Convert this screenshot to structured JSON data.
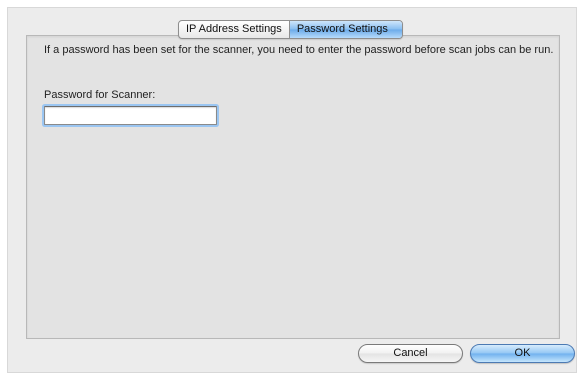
{
  "tabs": [
    {
      "label": "IP Address Settings",
      "selected": false
    },
    {
      "label": "Password Settings",
      "selected": true
    }
  ],
  "description": "If a password has been set for the scanner, you need to enter the password before scan jobs can be run.",
  "password_field": {
    "label": "Password for Scanner:",
    "value": "",
    "placeholder": ""
  },
  "buttons": {
    "cancel_label": "Cancel",
    "ok_label": "OK"
  },
  "colors": {
    "accent": "#86bdf1",
    "window_bg": "#ececec",
    "panel_bg": "#e3e3e3"
  }
}
